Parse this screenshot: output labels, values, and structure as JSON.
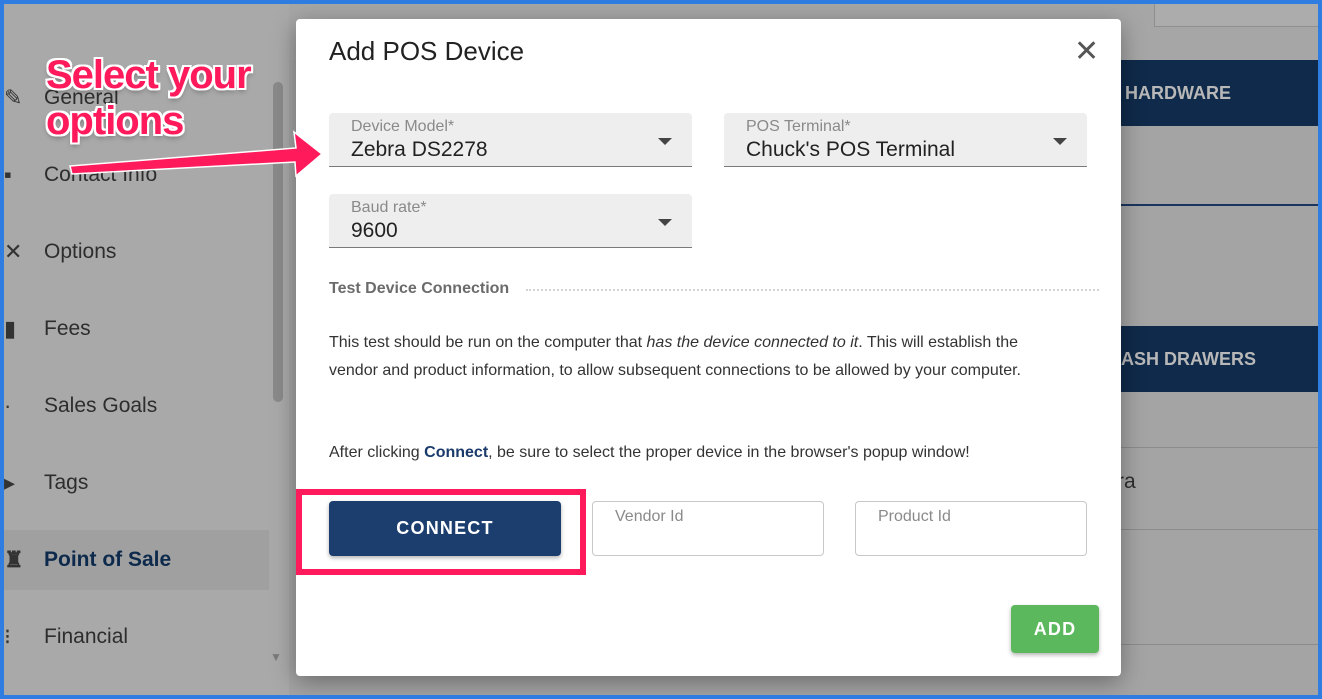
{
  "background": {
    "sidebar": {
      "items": [
        {
          "label": "General",
          "icon": "pencil-icon"
        },
        {
          "label": "Contact Info",
          "icon": "contact-icon"
        },
        {
          "label": "Options",
          "icon": "tools-icon"
        },
        {
          "label": "Fees",
          "icon": "fees-icon"
        },
        {
          "label": "Sales Goals",
          "icon": "goal-icon"
        },
        {
          "label": "Tags",
          "icon": "tag-icon"
        },
        {
          "label": "Point of Sale",
          "icon": "pos-icon"
        },
        {
          "label": "Financial",
          "icon": "financial-icon"
        }
      ],
      "active_item": "Point of Sale"
    },
    "panels": {
      "hardware_header": "HARDWARE",
      "cash_drawers_header": "ASH DRAWERS",
      "partial_text": "ra"
    }
  },
  "modal": {
    "title": "Add POS Device",
    "close_label": "✕",
    "fields": {
      "device_model": {
        "label": "Device Model*",
        "value": "Zebra DS2278"
      },
      "pos_terminal": {
        "label": "POS Terminal*",
        "value": "Chuck's POS Terminal"
      },
      "baud_rate": {
        "label": "Baud rate*",
        "value": "9600"
      }
    },
    "test_section": {
      "title": "Test Device Connection",
      "para1_a": "This test should be run on the computer that ",
      "para1_em": "has the device connected to it",
      "para1_b": ". This will establish the vendor and product information, to allow subsequent connections to be allowed by your computer.",
      "para2_a": "After clicking ",
      "para2_strong": "Connect",
      "para2_b": ", be sure to select the proper device in the browser's popup window!"
    },
    "connect_button": "CONNECT",
    "vendor_id": {
      "placeholder": "Vendor Id"
    },
    "product_id": {
      "placeholder": "Product Id"
    },
    "add_button": "ADD"
  },
  "annotation": {
    "text_line1": "Select your",
    "text_line2": "options",
    "color": "#ff1a5c"
  }
}
